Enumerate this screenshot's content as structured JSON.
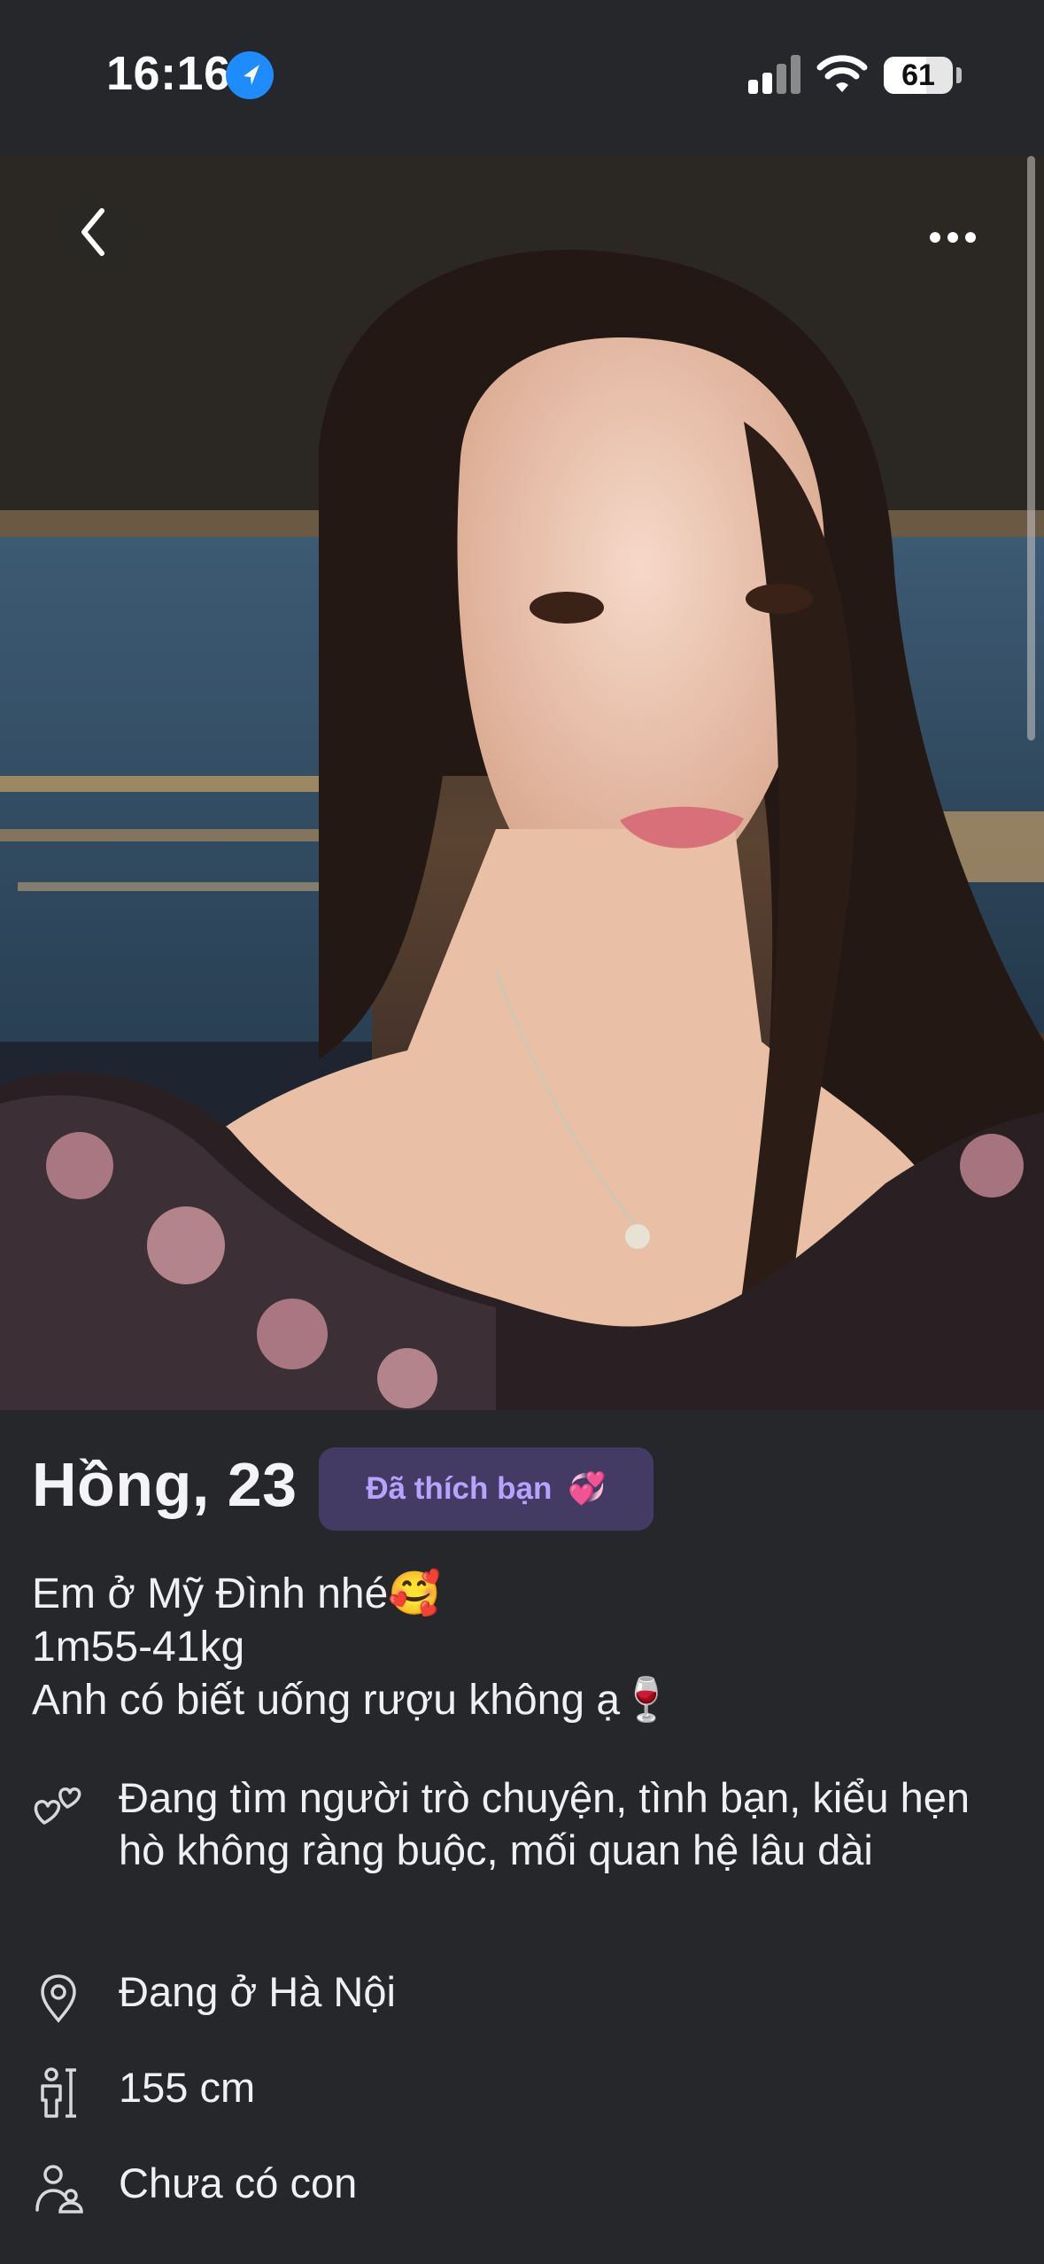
{
  "status_bar": {
    "time": "16:16",
    "battery": "61",
    "battery_level": 0.61,
    "location_icon": "location-arrow-icon",
    "signal_icon": "cellular-signal-icon",
    "wifi_icon": "wifi-icon"
  },
  "nav": {
    "back_icon": "chevron-left-icon",
    "more_icon": "more-horizontal-icon"
  },
  "profile": {
    "name_age": "Hồng, 23",
    "liked_label": "Đã thích bạn",
    "liked_emoji": "💞",
    "bio": [
      "Em ở Mỹ Đình nhé🥰",
      "1m55-41kg",
      "Anh có biết uống rượu không ạ🍷"
    ],
    "details": [
      {
        "icon": "hearts-icon",
        "text": "Đang tìm người trò chuyện, tình bạn, kiểu hẹn hò không ràng buộc, mối quan hệ lâu dài"
      },
      {
        "icon": "location-pin-icon",
        "text": "Đang ở Hà Nội"
      },
      {
        "icon": "height-icon",
        "text": "155 cm"
      },
      {
        "icon": "children-icon",
        "text": "Chưa có con"
      }
    ]
  },
  "colors": {
    "background": "#26272b",
    "badge_bg": "#433b63",
    "badge_text": "#b7a3ff",
    "status_accent": "#1e8bff"
  }
}
